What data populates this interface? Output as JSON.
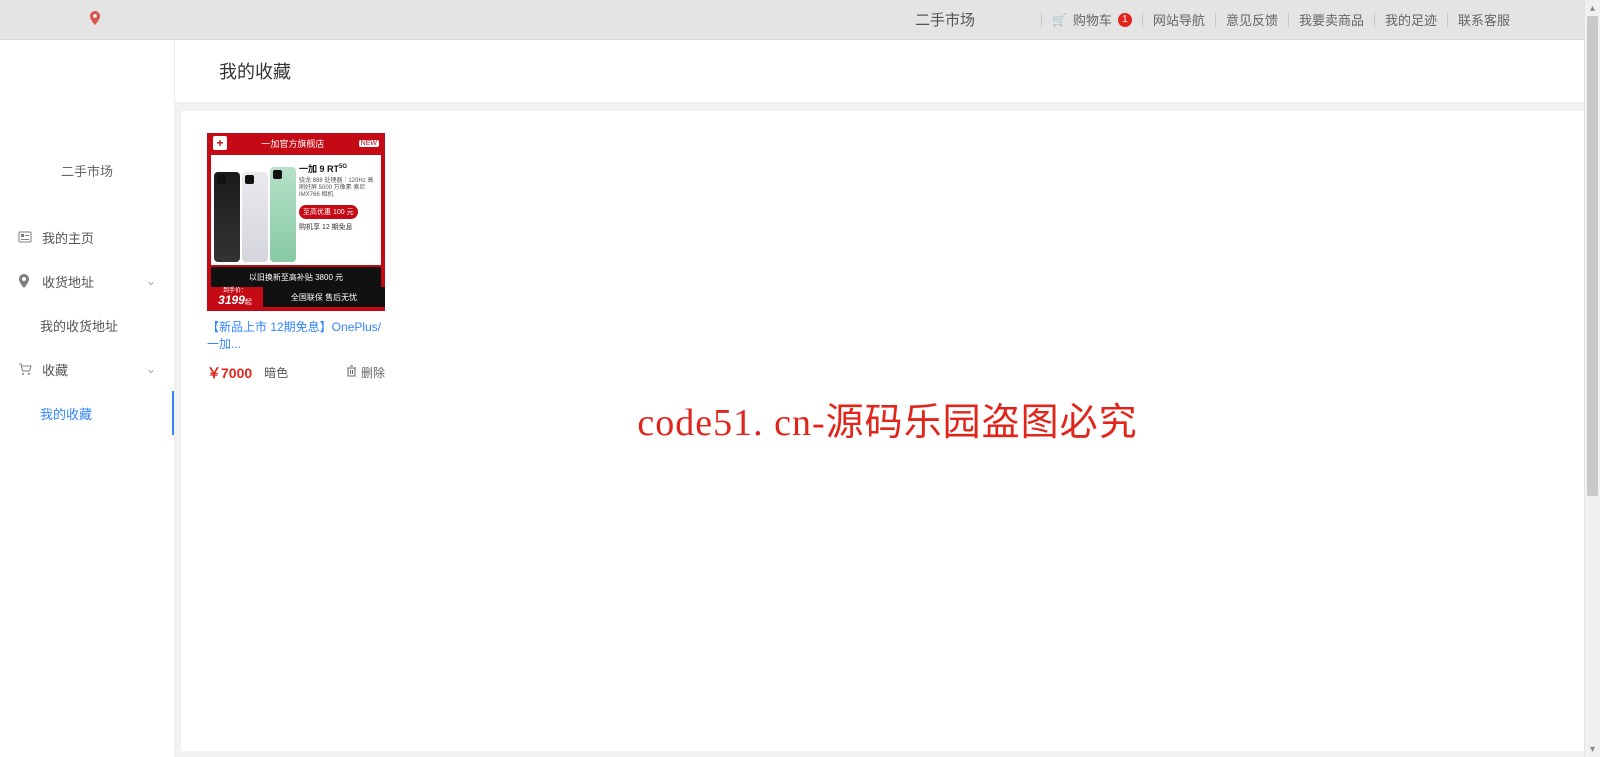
{
  "topbar": {
    "site_name": "二手市场",
    "cart_label": "购物车",
    "cart_badge": "1",
    "links": {
      "nav": "网站导航",
      "feedback": "意见反馈",
      "sell": "我要卖商品",
      "footprint": "我的足迹",
      "service": "联系客服"
    }
  },
  "sidebar": {
    "site_name": "二手市场",
    "items": {
      "home": "我的主页",
      "address": "收货地址",
      "address_sub": "我的收货地址",
      "fav": "收藏",
      "fav_sub": "我的收藏"
    }
  },
  "page": {
    "title": "我的收藏"
  },
  "product": {
    "banner_tag": "一加官方旗舰店",
    "model": "一加 9 RT",
    "model_sup": "5G",
    "spec_line": "骁龙 888 处理器｜120Hz 高刷好屏\n5000 万像素 索尼 IMX766 相机",
    "pill1": "至高优惠 100 元",
    "pill2": "购机享 12 期免息",
    "price_label": "到手价：",
    "price_big": "3199",
    "price_suffix": "起",
    "black1": "以旧换新至高补贴 3800 元",
    "black2": "全国联保 售后无忧",
    "title": "【新品上市 12期免息】OnePlus/一加...",
    "price": "￥7000",
    "spec": "暗色",
    "delete": "删除"
  },
  "watermark": "code51. cn-源码乐园盗图必究"
}
